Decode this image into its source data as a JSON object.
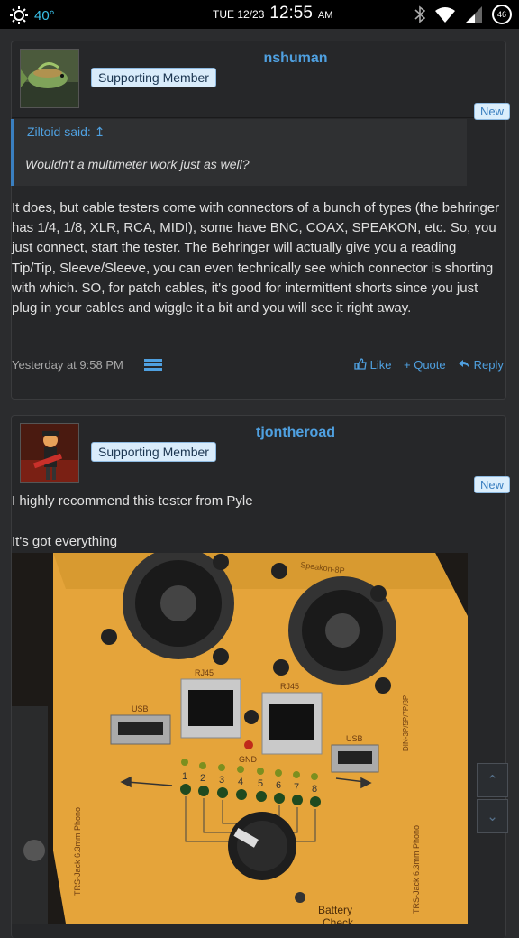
{
  "status": {
    "temperature": "40°",
    "date": "TUE 12/23",
    "time": "12:55",
    "ampm": "AM",
    "battery": "46"
  },
  "posts": [
    {
      "username": "nshuman",
      "badge": "Supporting Member",
      "new_label": "New",
      "quote_author": "Ziltoid said: ↥",
      "quote_text": "Wouldn't a multimeter work just as well?",
      "paragraph": "It does, but cable testers come with connectors of a bunch of types (the behringer has 1/4, 1/8, XLR, RCA, MIDI), some have BNC, COAX, SPEAKON, etc. So, you just connect, start the tester. The Behringer will actually give you a reading Tip/Tip, Sleeve/Sleeve, you can even technically see which connector is shorting with which. SO, for patch cables, it's good for intermittent shorts since you just plug in your cables and wiggle it a bit and you will see it right away.",
      "timestamp": "Yesterday at 9:58 PM",
      "actions": {
        "like": "Like",
        "quote": "+ Quote",
        "reply": "Reply"
      }
    },
    {
      "username": "tjontheroad",
      "badge": "Supporting Member",
      "new_label": "New",
      "line1": "I highly recommend this tester from Pyle",
      "line2": "It's got everything",
      "photo_labels": {
        "speakon": "Speakon-8P",
        "rj45a": "RJ45",
        "rj45b": "RJ45",
        "usb_left": "USB",
        "usb_right": "USB",
        "gnd": "GND",
        "trs_left": "TRS-Jack 6.3mm   Phono",
        "trs_right": "TRS-Jack 6.3mm   Phono",
        "din": "DIN-3P/5P/7P/8P",
        "battery": "Battery",
        "check": "Check",
        "pins": [
          "1",
          "2",
          "3",
          "4",
          "5",
          "6",
          "7",
          "8"
        ]
      }
    }
  ],
  "scroll": {
    "up": "⌃",
    "down": "⌄"
  }
}
